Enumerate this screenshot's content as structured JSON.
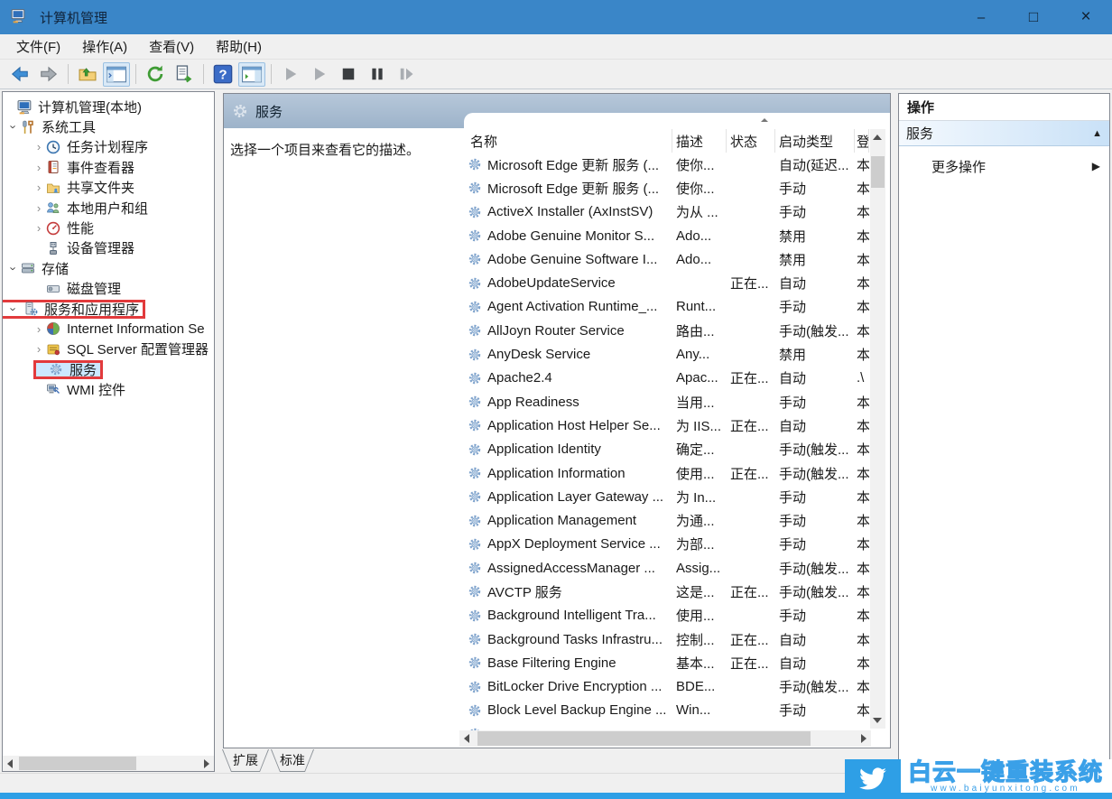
{
  "window": {
    "title": "计算机管理",
    "controls": [
      {
        "name": "minimize-button",
        "icon": "minimize-icon"
      },
      {
        "name": "maximize-button",
        "icon": "maximize-icon"
      },
      {
        "name": "close-button",
        "icon": "close-icon"
      }
    ]
  },
  "menu": {
    "items": [
      {
        "label": "文件(F)"
      },
      {
        "label": "操作(A)"
      },
      {
        "label": "查看(V)"
      },
      {
        "label": "帮助(H)"
      }
    ]
  },
  "toolbar": {
    "buttons": [
      {
        "name": "back-button",
        "icon": "back-icon"
      },
      {
        "name": "forward-button",
        "icon": "forward-icon"
      },
      {
        "type": "separator"
      },
      {
        "name": "up-level-button",
        "icon": "folder-up-icon"
      },
      {
        "name": "show-console-tree-button",
        "icon": "console-tree-icon",
        "active": true
      },
      {
        "type": "separator2"
      },
      {
        "name": "refresh-button",
        "icon": "refresh-icon"
      },
      {
        "name": "export-list-button",
        "icon": "export-list-icon"
      },
      {
        "type": "separator"
      },
      {
        "name": "help-button",
        "icon": "help-icon"
      },
      {
        "name": "show-action-pane-button",
        "icon": "action-pane-icon",
        "active": true
      },
      {
        "type": "separator2"
      },
      {
        "name": "start-service-button",
        "icon": "play-icon"
      },
      {
        "name": "resume-service-button",
        "icon": "play-icon"
      },
      {
        "name": "stop-service-button",
        "icon": "stop-icon"
      },
      {
        "name": "pause-service-button",
        "icon": "pause-icon"
      },
      {
        "name": "restart-service-button",
        "icon": "step-icon"
      }
    ]
  },
  "tree": {
    "items": [
      {
        "label": "计算机管理(本地)",
        "level": 0,
        "chevron": "none",
        "icon": "computer-icon"
      },
      {
        "label": "系统工具",
        "level": 1,
        "chevron": "expanded",
        "icon": "system-tools-icon"
      },
      {
        "label": "任务计划程序",
        "level": 2,
        "chevron": "collapsed",
        "icon": "task-scheduler-icon"
      },
      {
        "label": "事件查看器",
        "level": 2,
        "chevron": "collapsed",
        "icon": "event-viewer-icon"
      },
      {
        "label": "共享文件夹",
        "level": 2,
        "chevron": "collapsed",
        "icon": "shared-folders-icon"
      },
      {
        "label": "本地用户和组",
        "level": 2,
        "chevron": "collapsed",
        "icon": "local-users-icon"
      },
      {
        "label": "性能",
        "level": 2,
        "chevron": "collapsed",
        "icon": "performance-icon"
      },
      {
        "label": "设备管理器",
        "level": 2,
        "chevron": "none",
        "icon": "device-manager-icon"
      },
      {
        "label": "存储",
        "level": 1,
        "chevron": "expanded",
        "icon": "storage-icon"
      },
      {
        "label": "磁盘管理",
        "level": 2,
        "chevron": "none",
        "icon": "disk-management-icon"
      },
      {
        "label": "服务和应用程序",
        "level": 1,
        "chevron": "expanded",
        "icon": "services-apps-icon",
        "red_box": true
      },
      {
        "label": "Internet Information Se",
        "level": 2,
        "chevron": "collapsed",
        "icon": "iis-icon"
      },
      {
        "label": "SQL Server 配置管理器",
        "level": 2,
        "chevron": "collapsed",
        "icon": "sql-server-icon"
      },
      {
        "label": "服务",
        "level": 2,
        "chevron": "none",
        "icon": "services-gear-icon",
        "selected": true,
        "red_box": true
      },
      {
        "label": "WMI 控件",
        "level": 2,
        "chevron": "none",
        "icon": "wmi-icon"
      }
    ]
  },
  "center": {
    "header_title": "服务",
    "description_hint": "选择一个项目来查看它的描述。"
  },
  "services": {
    "columns": [
      "名称",
      "描述",
      "状态",
      "启动类型",
      "登"
    ],
    "rows": [
      {
        "name": "Microsoft Edge 更新 服务 (...",
        "desc": "使你...",
        "status": "",
        "startup": "自动(延迟...",
        "logon": "本"
      },
      {
        "name": "Microsoft Edge 更新 服务 (...",
        "desc": "使你...",
        "status": "",
        "startup": "手动",
        "logon": "本"
      },
      {
        "name": "ActiveX Installer (AxInstSV)",
        "desc": "为从 ...",
        "status": "",
        "startup": "手动",
        "logon": "本"
      },
      {
        "name": "Adobe Genuine Monitor S...",
        "desc": "Ado...",
        "status": "",
        "startup": "禁用",
        "logon": "本"
      },
      {
        "name": "Adobe Genuine Software I...",
        "desc": "Ado...",
        "status": "",
        "startup": "禁用",
        "logon": "本"
      },
      {
        "name": "AdobeUpdateService",
        "desc": "",
        "status": "正在...",
        "startup": "自动",
        "logon": "本"
      },
      {
        "name": "Agent Activation Runtime_...",
        "desc": "Runt...",
        "status": "",
        "startup": "手动",
        "logon": "本"
      },
      {
        "name": "AllJoyn Router Service",
        "desc": "路由...",
        "status": "",
        "startup": "手动(触发...",
        "logon": "本"
      },
      {
        "name": "AnyDesk Service",
        "desc": "Any...",
        "status": "",
        "startup": "禁用",
        "logon": "本"
      },
      {
        "name": "Apache2.4",
        "desc": "Apac...",
        "status": "正在...",
        "startup": "自动",
        "logon": ".\\"
      },
      {
        "name": "App Readiness",
        "desc": "当用...",
        "status": "",
        "startup": "手动",
        "logon": "本"
      },
      {
        "name": "Application Host Helper Se...",
        "desc": "为 IIS...",
        "status": "正在...",
        "startup": "自动",
        "logon": "本"
      },
      {
        "name": "Application Identity",
        "desc": "确定...",
        "status": "",
        "startup": "手动(触发...",
        "logon": "本"
      },
      {
        "name": "Application Information",
        "desc": "使用...",
        "status": "正在...",
        "startup": "手动(触发...",
        "logon": "本"
      },
      {
        "name": "Application Layer Gateway ...",
        "desc": "为 In...",
        "status": "",
        "startup": "手动",
        "logon": "本"
      },
      {
        "name": "Application Management",
        "desc": "为通...",
        "status": "",
        "startup": "手动",
        "logon": "本"
      },
      {
        "name": "AppX Deployment Service ...",
        "desc": "为部...",
        "status": "",
        "startup": "手动",
        "logon": "本"
      },
      {
        "name": "AssignedAccessManager ...",
        "desc": "Assig...",
        "status": "",
        "startup": "手动(触发...",
        "logon": "本"
      },
      {
        "name": "AVCTP 服务",
        "desc": "这是...",
        "status": "正在...",
        "startup": "手动(触发...",
        "logon": "本"
      },
      {
        "name": "Background Intelligent Tra...",
        "desc": "使用...",
        "status": "",
        "startup": "手动",
        "logon": "本"
      },
      {
        "name": "Background Tasks Infrastru...",
        "desc": "控制...",
        "status": "正在...",
        "startup": "自动",
        "logon": "本"
      },
      {
        "name": "Base Filtering Engine",
        "desc": "基本...",
        "status": "正在...",
        "startup": "自动",
        "logon": "本"
      },
      {
        "name": "BitLocker Drive Encryption ...",
        "desc": "BDE...",
        "status": "",
        "startup": "手动(触发...",
        "logon": "本"
      },
      {
        "name": "Block Level Backup Engine ...",
        "desc": "Win...",
        "status": "",
        "startup": "手动",
        "logon": "本"
      }
    ]
  },
  "actions": {
    "title": "操作",
    "group_title": "服务",
    "more_actions": "更多操作"
  },
  "tabs": [
    {
      "label": "扩展"
    },
    {
      "label": "标准"
    }
  ],
  "watermark": {
    "title": "白云一键重装系统",
    "url": "www.baiyunxitong.com"
  },
  "colors": {
    "titlebar_blue": "#3a86c8",
    "annotation_red": "#e23a3c",
    "selection_blue": "#cce8ff",
    "center_header_blue": "#a8bcd1",
    "watermark_blue": "#2e9fe6"
  }
}
